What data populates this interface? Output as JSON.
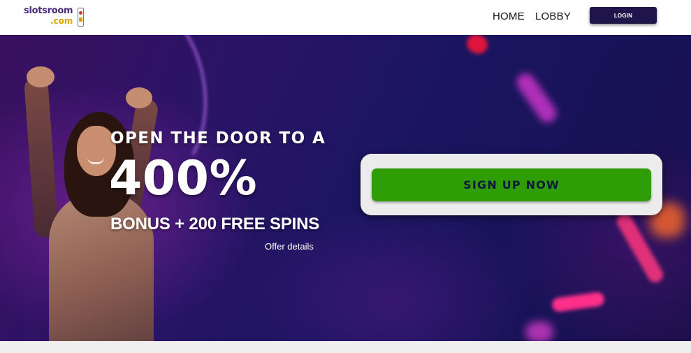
{
  "header": {
    "logo_line1": "slotsroom",
    "logo_line2": ".com",
    "nav": {
      "home": "HOME",
      "lobby": "LOBBY"
    },
    "login_label": "LOGIN"
  },
  "hero": {
    "headline": "OPEN THE DOOR TO A",
    "percent": "400%",
    "bonus": "BONUS + 200 FREE SPINS",
    "offer_details": "Offer details",
    "signup_label": "SIGN UP NOW"
  },
  "colors": {
    "login_bg": "#20154a",
    "signup_green": "#2f9e06",
    "logo_purple": "#4a2a7a",
    "logo_gold": "#d9a400",
    "hero_dark": "#1b1560"
  }
}
